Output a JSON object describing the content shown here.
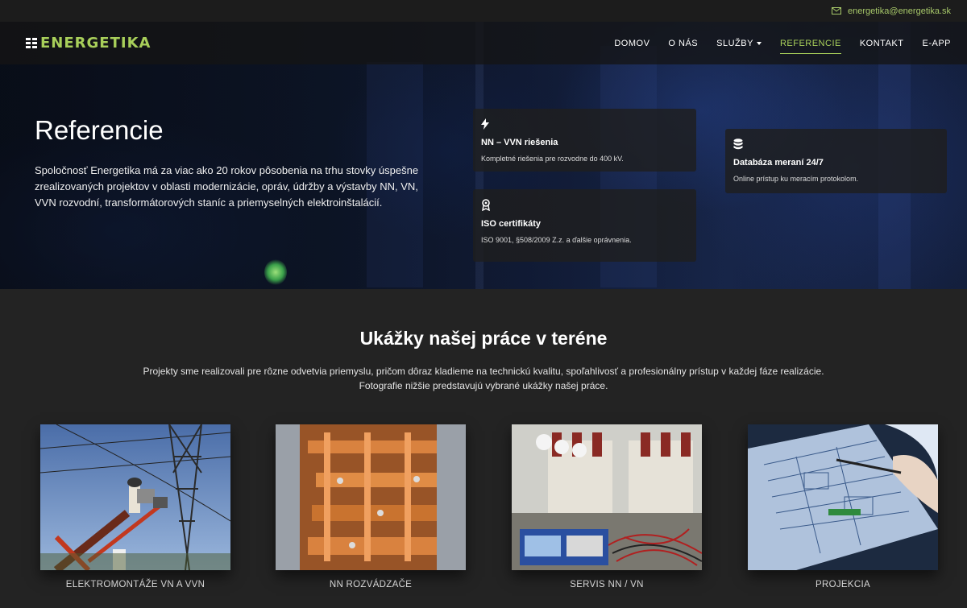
{
  "topbar": {
    "email": "energetika@energetika.sk"
  },
  "header": {
    "logo_text": "ENERGETIKA",
    "nav": [
      {
        "label": "DOMOV"
      },
      {
        "label": "O NÁS"
      },
      {
        "label": "SLUŽBY",
        "has_dropdown": true
      },
      {
        "label": "REFERENCIE",
        "active": true
      },
      {
        "label": "KONTAKT"
      },
      {
        "label": "E-APP"
      }
    ]
  },
  "hero": {
    "title": "Referencie",
    "text": "Spoločnosť Energetika má za viac ako 20 rokov pôsobenia na trhu stovky úspešne zrealizovaných projektov v oblasti modernizácie, opráv, údržby a výstavby NN, VN, VVN rozvodní, transformátorových staníc a priemyselných elektroinštalácií.",
    "cards": [
      {
        "icon": "bolt-icon",
        "title": "NN – VVN riešenia",
        "desc": "Kompletné riešenia pre rozvodne do 400 kV."
      },
      {
        "icon": "award-icon",
        "title": "ISO certifikáty",
        "desc": "ISO 9001, §508/2009 Z.z. a ďalšie oprávnenia."
      },
      {
        "icon": "database-icon",
        "title": "Databáza meraní 24/7",
        "desc": "Online prístup ku meracím protokolom."
      }
    ]
  },
  "section": {
    "title": "Ukážky našej práce v teréne",
    "text_line1": "Projekty sme realizovali pre rôzne odvetvia priemyslu, pričom dôraz kladieme na technickú kvalitu, spoľahlivosť a profesionálny prístup v každej fáze realizácie.",
    "text_line2": "Fotografie nižšie predstavujú vybrané ukážky našej práce."
  },
  "gallery": [
    {
      "label": "ELEKTROMONTÁŽE VN A VVN"
    },
    {
      "label": "NN ROZVÁDZAČE"
    },
    {
      "label": "SERVIS NN / VN"
    },
    {
      "label": "PROJEKCIA"
    }
  ],
  "colors": {
    "accent": "#a8cf5a",
    "background": "#232323",
    "card": "#1e1e1e"
  }
}
